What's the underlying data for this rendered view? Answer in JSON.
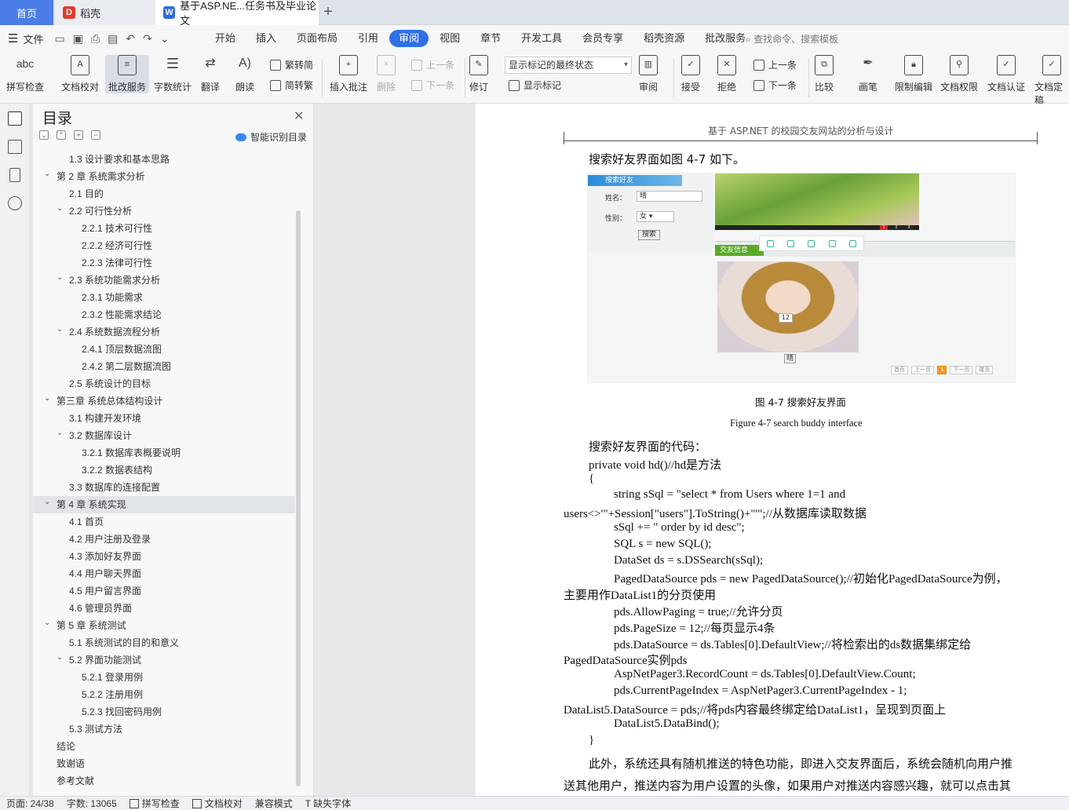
{
  "tabs": {
    "home": "首页",
    "daoke": "稻壳",
    "doc": "基于ASP.NE...任务书及毕业论文",
    "add": "+"
  },
  "menubar": {
    "file": "文件",
    "tabs": [
      "开始",
      "插入",
      "页面布局",
      "引用",
      "审阅",
      "视图",
      "章节",
      "开发工具",
      "会员专享",
      "稻壳资源",
      "批改服务"
    ],
    "active_tab": "审阅",
    "search": "查找命令、搜索模板"
  },
  "ribbon": {
    "spell_check": "拼写检查",
    "doc_proof": "文档校对",
    "correction": "批改服务",
    "word_count": "字数统计",
    "translate": "翻译",
    "read_aloud": "朗读",
    "trad": "繁转简",
    "simp": "简转繁",
    "insert_comment": "插入批注",
    "delete": "删除",
    "prev_comment": "上一条",
    "next_comment": "下一条",
    "revise": "修订",
    "markup_state": "显示标记的最终状态",
    "show_markup": "显示标记",
    "review": "审阅",
    "accept": "接受",
    "reject": "拒绝",
    "prev": "上一条",
    "next": "下一条",
    "compare": "比较",
    "pen": "画笔",
    "restrict": "限制编辑",
    "doc_rights": "文档权限",
    "doc_auth": "文档认证",
    "doc_final": "文档定稿"
  },
  "toc": {
    "title": "目录",
    "smart": "智能识别目录",
    "items": [
      {
        "label": "1.3 设计要求和基本思路",
        "level": 2,
        "caret": ""
      },
      {
        "label": "第 2 章  系统需求分析",
        "level": 1,
        "caret": "⌄"
      },
      {
        "label": "2.1 目的",
        "level": 2,
        "caret": ""
      },
      {
        "label": "2.2 可行性分析",
        "level": 2,
        "caret": "⌄"
      },
      {
        "label": "2.2.1 技术可行性",
        "level": 3,
        "caret": ""
      },
      {
        "label": "2.2.2 经济可行性",
        "level": 3,
        "caret": ""
      },
      {
        "label": "2.2.3 法律可行性",
        "level": 3,
        "caret": ""
      },
      {
        "label": "2.3 系统功能需求分析",
        "level": 2,
        "caret": "⌄"
      },
      {
        "label": "2.3.1 功能需求",
        "level": 3,
        "caret": ""
      },
      {
        "label": "2.3.2 性能需求结论",
        "level": 3,
        "caret": ""
      },
      {
        "label": "2.4 系统数据流程分析",
        "level": 2,
        "caret": "⌄"
      },
      {
        "label": "2.4.1 顶层数据流图",
        "level": 3,
        "caret": ""
      },
      {
        "label": "2.4.2 第二层数据流图",
        "level": 3,
        "caret": ""
      },
      {
        "label": "2.5 系统设计的目标",
        "level": 2,
        "caret": ""
      },
      {
        "label": "第三章  系统总体结构设计",
        "level": 1,
        "caret": "⌄"
      },
      {
        "label": "3.1 构建开发环境",
        "level": 2,
        "caret": ""
      },
      {
        "label": "3.2 数据库设计",
        "level": 2,
        "caret": "⌄"
      },
      {
        "label": "3.2.1 数据库表概要说明",
        "level": 3,
        "caret": ""
      },
      {
        "label": "3.2.2 数据表结构",
        "level": 3,
        "caret": ""
      },
      {
        "label": "3.3 数据库的连接配置",
        "level": 2,
        "caret": ""
      },
      {
        "label": "第 4 章  系统实现",
        "level": 1,
        "caret": "⌄",
        "active": true
      },
      {
        "label": "4.1 首页",
        "level": 2,
        "caret": ""
      },
      {
        "label": "4.2 用户注册及登录",
        "level": 2,
        "caret": ""
      },
      {
        "label": "4.3 添加好友界面",
        "level": 2,
        "caret": ""
      },
      {
        "label": "4.4 用户聊天界面",
        "level": 2,
        "caret": ""
      },
      {
        "label": "4.5 用户留言界面",
        "level": 2,
        "caret": ""
      },
      {
        "label": "4.6 管理员界面",
        "level": 2,
        "caret": ""
      },
      {
        "label": "第 5 章  系统测试",
        "level": 1,
        "caret": "⌄"
      },
      {
        "label": "5.1 系统测试的目的和意义",
        "level": 2,
        "caret": ""
      },
      {
        "label": "5.2 界面功能测试",
        "level": 2,
        "caret": "⌄"
      },
      {
        "label": "5.2.1 登录用例",
        "level": 3,
        "caret": ""
      },
      {
        "label": "5.2.2 注册用例",
        "level": 3,
        "caret": ""
      },
      {
        "label": "5.2.3 找回密码用例",
        "level": 3,
        "caret": ""
      },
      {
        "label": "5.3 测试方法",
        "level": 2,
        "caret": ""
      },
      {
        "label": "结论",
        "level": 1,
        "caret": ""
      },
      {
        "label": "致谢语",
        "level": 1,
        "caret": ""
      },
      {
        "label": "参考文献",
        "level": 1,
        "caret": ""
      }
    ]
  },
  "page": {
    "header": "基于 ASP.NET 的校园交友网站的分析与设计",
    "intro": "搜索好友界面如图 4-7 如下。",
    "figure": {
      "search_header": "搜索好友",
      "name_label": "姓名：",
      "name_value": "晴",
      "gender_label": "性别：",
      "gender_value": "女",
      "search_button": "搜索",
      "pager_nums": [
        "1",
        "2",
        "3"
      ],
      "friend_label": "交友信息",
      "badge_num": "12",
      "person_name": "晴",
      "pager": [
        "首页",
        "上一页",
        "1",
        "下一页",
        "尾页"
      ]
    },
    "caption_cn": "图 4-7 搜索好友界面",
    "caption_en": "Figure 4-7 search buddy interface",
    "code_title": "搜索好友界面的代码：",
    "lines": [
      "private void hd()//hd是方法",
      "{",
      "string sSql = \"select * from Users where 1=1 and",
      "users<>'\"+Session[\"users\"].ToString()+\"'\";//从数据库读取数据",
      "sSql += \" order by id desc\";",
      "SQL s = new SQL();",
      "DataSet ds = s.DSSearch(sSql);",
      "PagedDataSource pds = new PagedDataSource();//初始化PagedDataSource为例，",
      "主要用作DataList1的分页使用",
      "pds.AllowPaging = true;//允许分页",
      "pds.PageSize = 12;//每页显示4条",
      "pds.DataSource = ds.Tables[0].DefaultView;//将检索出的ds数据集绑定给",
      "PagedDataSource实例pds",
      "AspNetPager3.RecordCount = ds.Tables[0].DefaultView.Count;",
      "pds.CurrentPageIndex = AspNetPager3.CurrentPageIndex - 1;",
      "DataList5.DataSource = pds;//将pds内容最终绑定给DataList1，呈现到页面上",
      "DataList5.DataBind();",
      "}"
    ],
    "para1": "此外，系统还具有随机推送的特色功能，即进入交友界面后，系统会随机向用户推",
    "para2": "送其他用户，推送内容为用户设置的头像，如果用户对推送内容感兴趣，就可以点击其"
  },
  "status": {
    "page": "页面: 24/38",
    "words": "字数: 13065",
    "spell": "拼写检查",
    "proof": "文档校对",
    "compat": "兼容模式",
    "missing_font": "缺失字体"
  }
}
